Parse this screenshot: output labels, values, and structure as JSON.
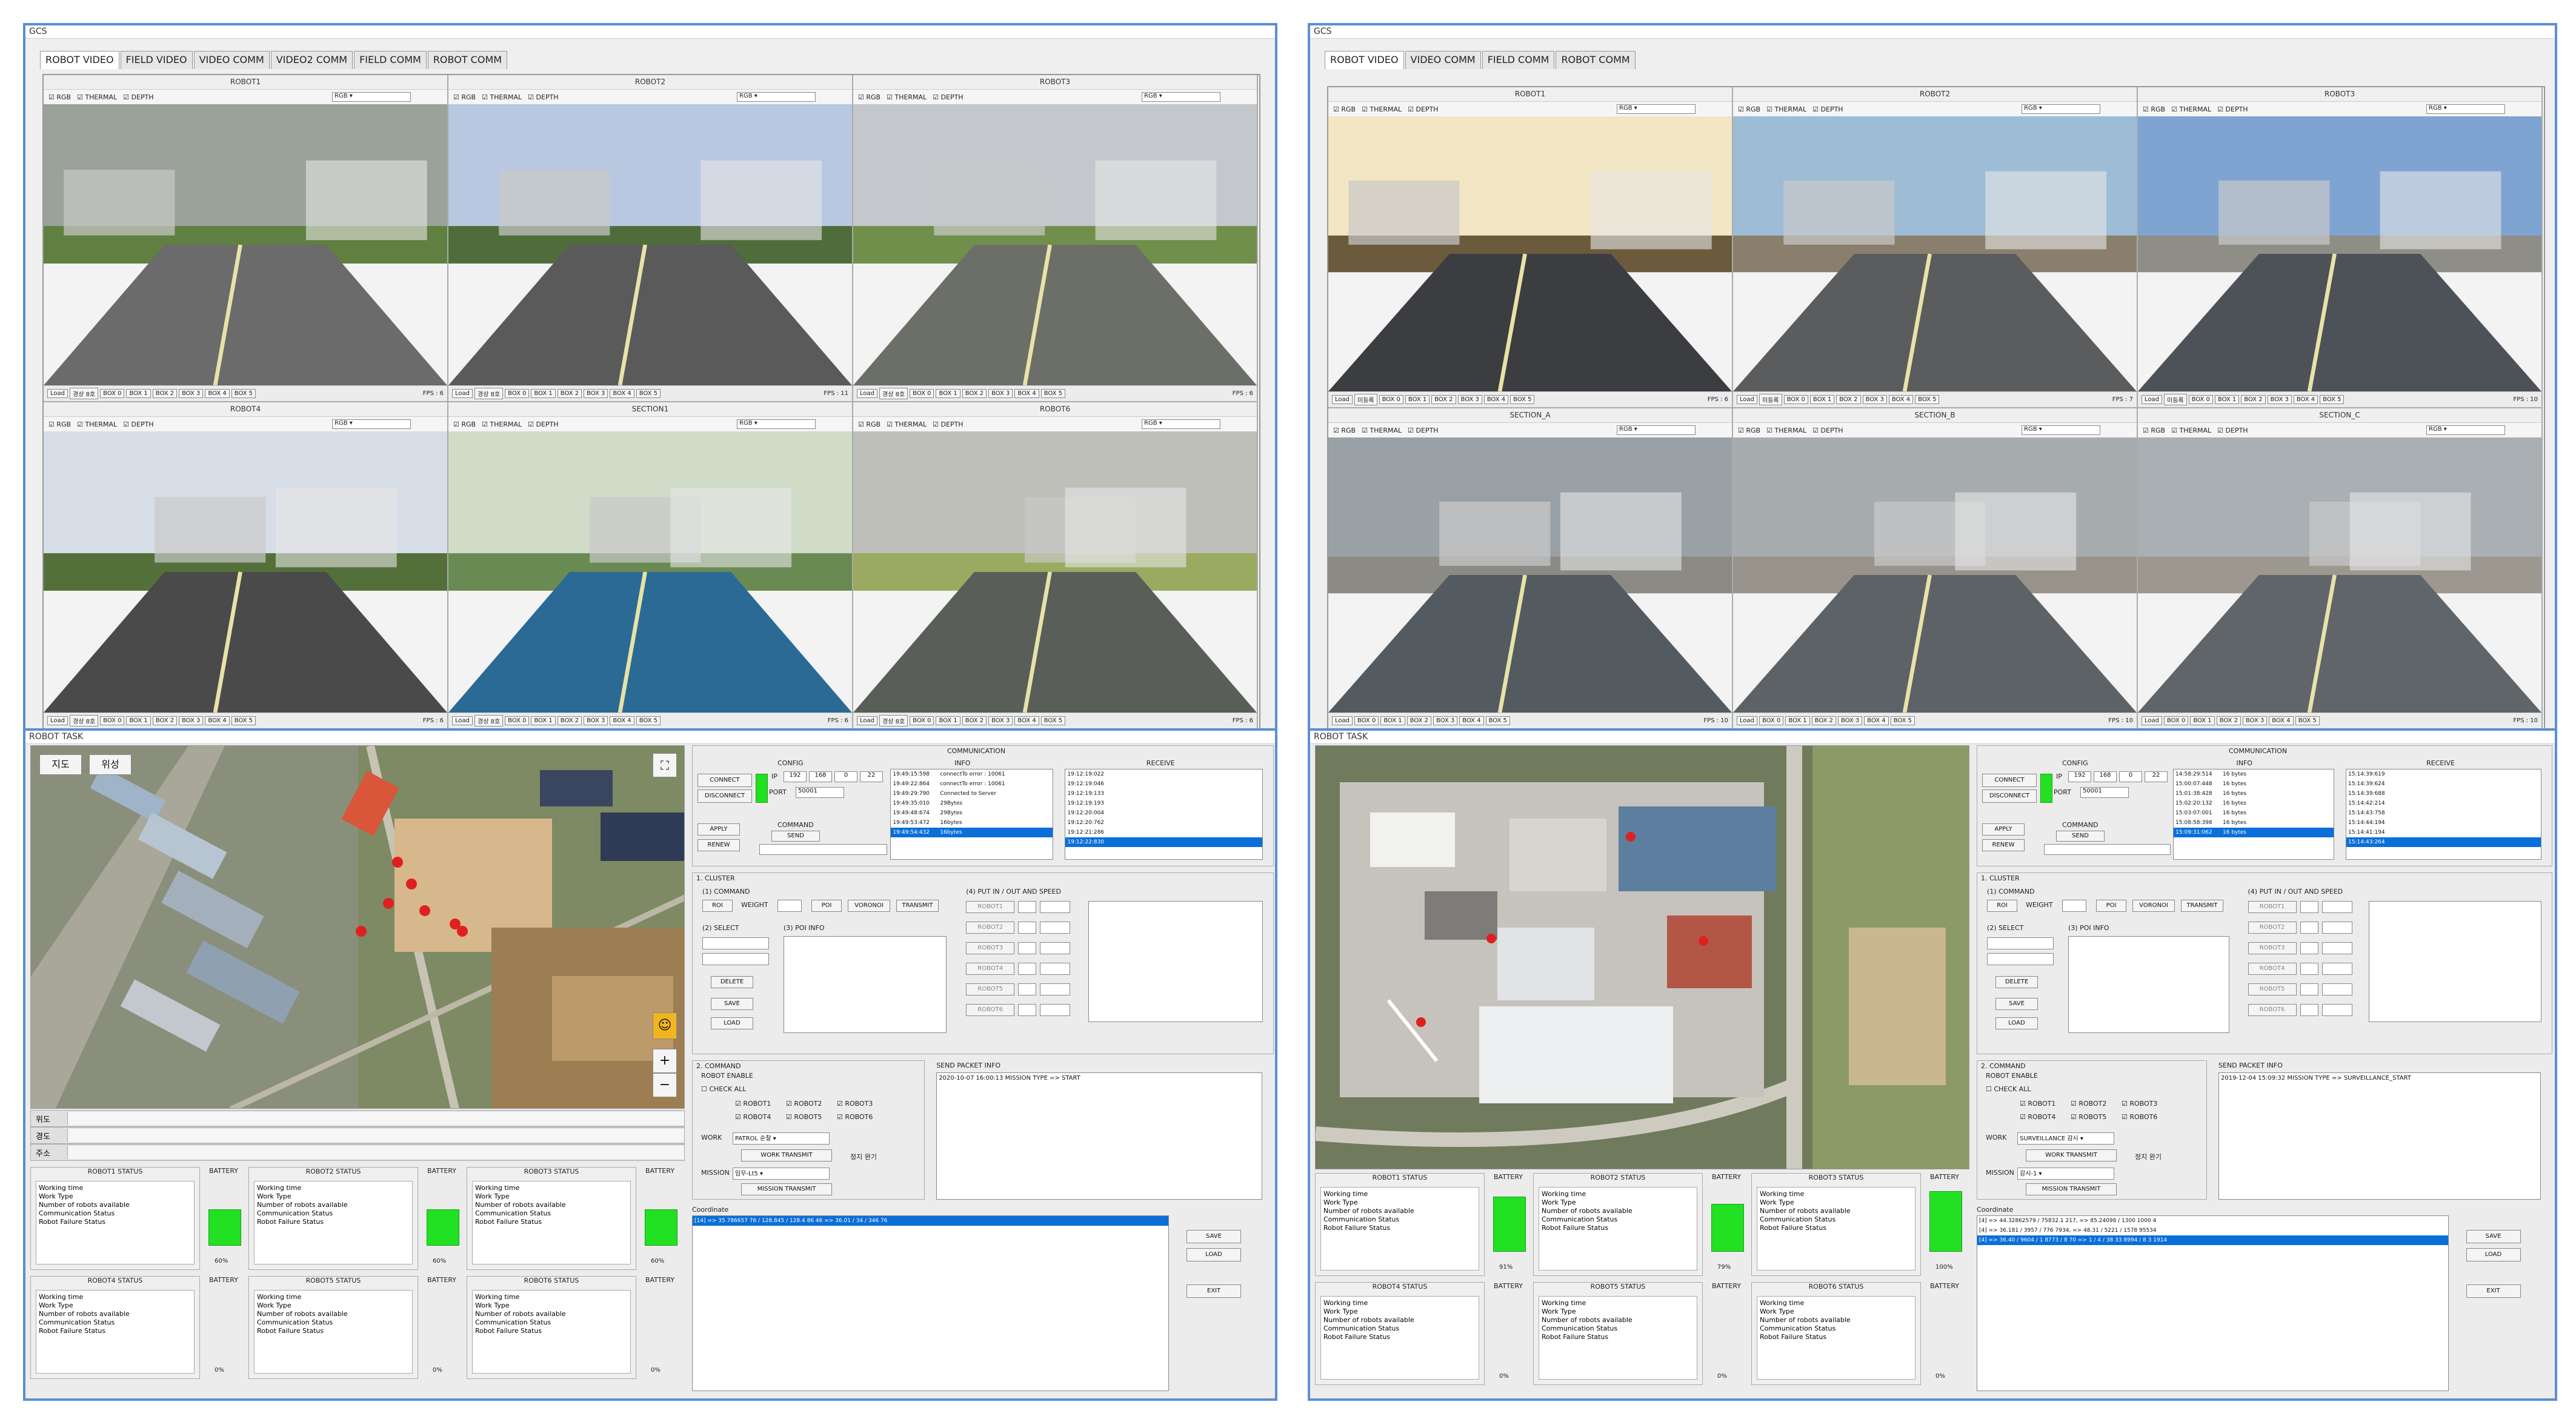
{
  "left": {
    "video_title": "GCS",
    "tabs": [
      "ROBOT VIDEO",
      "FIELD VIDEO",
      "VIDEO COMM",
      "VIDEO2 COMM",
      "FIELD COMM",
      "ROBOT COMM"
    ],
    "cells": [
      {
        "title": "ROBOT1",
        "fps": "FPS : 6",
        "plate": "경상 8호"
      },
      {
        "title": "ROBOT2",
        "fps": "FPS : 11",
        "plate": "경상 8호"
      },
      {
        "title": "ROBOT3",
        "fps": "FPS : 6",
        "plate": "경상 8호"
      },
      {
        "title": "ROBOT4",
        "fps": "FPS : 6",
        "plate": "경상 8호"
      },
      {
        "title": "SECTION1",
        "fps": "FPS : 6",
        "plate": "경상 8호"
      },
      {
        "title": "ROBOT6",
        "fps": "FPS : 6",
        "plate": "경상 8호"
      }
    ],
    "task_title": "ROBOT TASK",
    "map_buttons": [
      "지도",
      "위성"
    ],
    "map_rows": [
      "위도",
      "경도",
      "주소"
    ],
    "batteries": [
      "60%",
      "60%",
      "60%",
      "0%",
      "0%",
      "0%"
    ],
    "comm_log": [
      "19:49:15:598",
      "19:49:22:864",
      "19:49:29:790",
      "19:49:35:010",
      "19:49:48:674",
      "19:49:53:472",
      "19:49:54:432"
    ],
    "info_log": [
      "connectTo error : 10061",
      "connectTo error : 10061",
      "Connected to Server",
      "29Bytes",
      "29Bytes",
      "16bytes",
      "16bytes"
    ],
    "recv_log": [
      "19:12:19:022",
      "19:12:19:046",
      "19:12:19:133",
      "19:12:19:193",
      "19:12:20:004",
      "19:12:20:762",
      "19:12:21:286",
      "19:12:22:830"
    ],
    "packet": "2020-10-07 16:00:13 MISSION TYPE => START",
    "work": "PATROL 순찰",
    "mission": "임무-Lt5",
    "coordinate": "[14] => 35.786657 76 / 128.845 / 128.4 86 46 => 36.01 / 34 / 346 76"
  },
  "right": {
    "video_title": "GCS",
    "tabs": [
      "ROBOT VIDEO",
      "VIDEO COMM",
      "FIELD COMM",
      "ROBOT COMM"
    ],
    "cells": [
      {
        "title": "ROBOT1",
        "fps": "FPS : 6",
        "plate": "미등록"
      },
      {
        "title": "ROBOT2",
        "fps": "FPS : 7",
        "plate": "미등록"
      },
      {
        "title": "ROBOT3",
        "fps": "FPS : 10",
        "plate": "미등록"
      },
      {
        "title": "SECTION_A",
        "fps": "FPS : 10",
        "plate": ""
      },
      {
        "title": "SECTION_B",
        "fps": "FPS : 10",
        "plate": ""
      },
      {
        "title": "SECTION_C",
        "fps": "FPS : 10",
        "plate": ""
      }
    ],
    "task_title": "ROBOT TASK",
    "batteries": [
      "91%",
      "79%",
      "100%",
      "0%",
      "0%",
      "0%"
    ],
    "comm_log": [
      "14:58:29:514",
      "15:00:07:448",
      "15:01:38:428",
      "15:02:20:132",
      "15:03:07:001",
      "15:08:58:398",
      "15:09:31:062"
    ],
    "info_log": [
      "16 bytes",
      "16 bytes",
      "16 bytes",
      "16 bytes",
      "16 bytes",
      "16 bytes",
      "16 bytes"
    ],
    "recv_log": [
      "15:14:39:619",
      "15:14:39:624",
      "15:14:39:688",
      "15:14:42:214",
      "15:14:43:758",
      "15:14:44:194",
      "15:14:41:194",
      "15:14:43:264"
    ],
    "packet": "2019-12-04 15:09:32 MISSION TYPE => SURVEILLANCE_START",
    "work": "SURVEILLANCE 감시",
    "mission": "감시-1",
    "coords": [
      "[4] => 44.32862579 / 75832.1 217, => 85.24098 / 1300 1000 4",
      "[4] => 36.181 / 3957 / 776 7934, => 48.31 / 5221 / 1578 95534",
      "[4] => 36.40 / 9604 / 1 8773 / 8 70 => 1 / 4 / 38 33 8994 / 8 3 1914"
    ]
  },
  "common": {
    "comm_header": "COMMUNICATION",
    "config": "CONFIG",
    "ip_label": "IP",
    "ip": [
      "192",
      "168",
      "0",
      "22"
    ],
    "port_label": "PORT",
    "port": "50001",
    "connect": "CONNECT",
    "disconnect": "DISCONNECT",
    "info": "INFO",
    "receive": "RECEIVE",
    "apply": "APPLY",
    "renew": "RENEW",
    "command": "COMMAND",
    "send": "SEND",
    "cluster": "1. CLUSTER",
    "c1": "(1) COMMAND",
    "roi": "ROI",
    "weight": "WEIGHT",
    "poi": "POI",
    "voronoi": "VORONOI",
    "transmit": "TRANSMIT",
    "c4": "(4) PUT IN / OUT AND SPEED",
    "c2": "(2) SELECT",
    "c3": "(3) POI INFO",
    "delete": "DELETE",
    "save": "SAVE",
    "load": "LOAD",
    "cmd2": "2. COMMAND",
    "robot_enable": "ROBOT ENABLE",
    "check_all": "CHECK ALL",
    "robots": [
      "ROBOT1",
      "ROBOT2",
      "ROBOT3",
      "ROBOT4",
      "ROBOT5",
      "ROBOT6"
    ],
    "work_label": "WORK",
    "work_transmit": "WORK TRANSMIT",
    "mission_label": "MISSION",
    "mission_transmit": "MISSION TRANSMIT",
    "stop": "정지 완기",
    "packet_info": "SEND PACKET INFO",
    "coordinate": "Coordinate",
    "exit": "EXIT",
    "status_titles": [
      "ROBOT1 STATUS",
      "ROBOT2 STATUS",
      "ROBOT3 STATUS",
      "ROBOT4 STATUS",
      "ROBOT5 STATUS",
      "ROBOT6 STATUS"
    ],
    "battery": "BATTERY",
    "status_rows": [
      "Working time",
      "Work Type",
      "Number of robots available",
      "Communication Status",
      "Robot Failure Status"
    ],
    "cell_opts": [
      "RGB",
      "THERMAL",
      "DEPTH"
    ],
    "rgb_select": "RGB",
    "load_btn": "Load",
    "box_labels": [
      "BOX 0",
      "BOX 1",
      "BOX 2",
      "BOX 3",
      "BOX 4",
      "BOX 5"
    ]
  },
  "colors": {
    "border": "#5b8fd0",
    "battery": "#22e022",
    "selection": "#0a6fd8"
  }
}
